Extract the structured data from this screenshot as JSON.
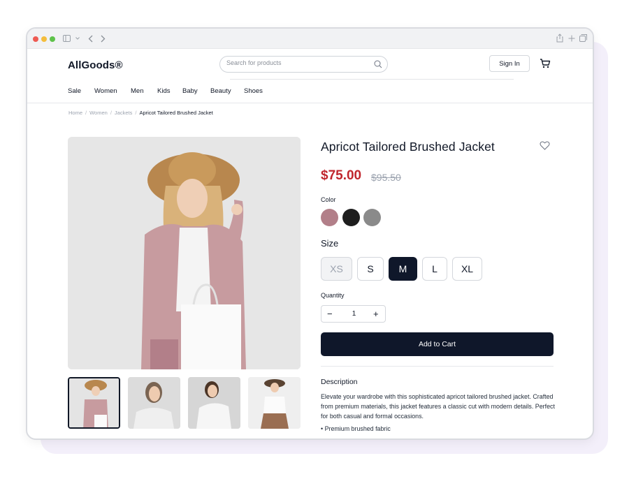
{
  "header": {
    "logo": "AllGoods®",
    "search_placeholder": "Search for products",
    "signin_label": "Sign In"
  },
  "nav": {
    "items": [
      "Sale",
      "Women",
      "Men",
      "Kids",
      "Baby",
      "Beauty",
      "Shoes"
    ]
  },
  "breadcrumb": {
    "items": [
      "Home",
      "Women",
      "Jackets"
    ],
    "current": "Apricot Tailored Brushed Jacket",
    "separator": "/"
  },
  "product": {
    "title": "Apricot Tailored Brushed Jacket",
    "price": "$75.00",
    "original_price": "$95.50",
    "color_label": "Color",
    "colors": [
      {
        "name": "rose",
        "hex": "#b27f89",
        "selected": true
      },
      {
        "name": "black",
        "hex": "#1e1e1e",
        "selected": false
      },
      {
        "name": "gray",
        "hex": "#8a8a8a",
        "selected": false
      }
    ],
    "size_label": "Size",
    "sizes": [
      {
        "label": "XS",
        "state": "disabled"
      },
      {
        "label": "S",
        "state": "available"
      },
      {
        "label": "M",
        "state": "selected"
      },
      {
        "label": "L",
        "state": "available"
      },
      {
        "label": "XL",
        "state": "available"
      }
    ],
    "quantity_label": "Quantity",
    "quantity": "1",
    "minus": "−",
    "plus": "+",
    "add_to_cart": "Add to Cart",
    "description_title": "Description",
    "description": "Elevate your wardrobe with this sophisticated apricot tailored brushed jacket. Crafted from premium materials, this jacket features a classic cut with modern details. Perfect for both casual and formal occasions.",
    "features": [
      "Premium brushed fabric"
    ]
  },
  "colors": {
    "accent": "#0f172a",
    "price": "#c0262d",
    "border": "#d4d7dc"
  },
  "icons": [
    "sidebar-icon",
    "chevron-down-icon",
    "back-icon",
    "forward-icon",
    "share-icon",
    "new-tab-icon",
    "tabs-icon",
    "search-icon",
    "cart-icon",
    "heart-icon"
  ]
}
